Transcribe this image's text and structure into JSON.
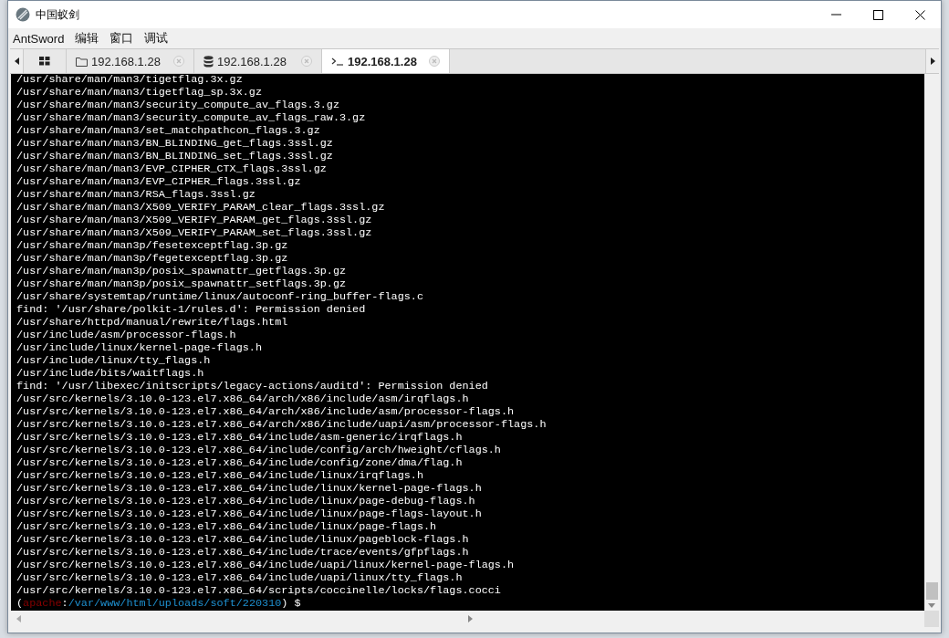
{
  "window": {
    "title": "中国蚁剑"
  },
  "menu": [
    "AntSword",
    "编辑",
    "窗口",
    "调试"
  ],
  "tabs": [
    {
      "kind": "home",
      "selected": false
    },
    {
      "kind": "files",
      "label": "192.168.1.28",
      "selected": false
    },
    {
      "kind": "database",
      "label": "192.168.1.28",
      "selected": false
    },
    {
      "kind": "terminal",
      "label": "192.168.1.28",
      "selected": true
    }
  ],
  "terminal": {
    "lines": [
      "/usr/share/man/man3/tigetflag.3x.gz",
      "/usr/share/man/man3/tigetflag_sp.3x.gz",
      "/usr/share/man/man3/security_compute_av_flags.3.gz",
      "/usr/share/man/man3/security_compute_av_flags_raw.3.gz",
      "/usr/share/man/man3/set_matchpathcon_flags.3.gz",
      "/usr/share/man/man3/BN_BLINDING_get_flags.3ssl.gz",
      "/usr/share/man/man3/BN_BLINDING_set_flags.3ssl.gz",
      "/usr/share/man/man3/EVP_CIPHER_CTX_flags.3ssl.gz",
      "/usr/share/man/man3/EVP_CIPHER_flags.3ssl.gz",
      "/usr/share/man/man3/RSA_flags.3ssl.gz",
      "/usr/share/man/man3/X509_VERIFY_PARAM_clear_flags.3ssl.gz",
      "/usr/share/man/man3/X509_VERIFY_PARAM_get_flags.3ssl.gz",
      "/usr/share/man/man3/X509_VERIFY_PARAM_set_flags.3ssl.gz",
      "/usr/share/man/man3p/fesetexceptflag.3p.gz",
      "/usr/share/man/man3p/fegetexceptflag.3p.gz",
      "/usr/share/man/man3p/posix_spawnattr_getflags.3p.gz",
      "/usr/share/man/man3p/posix_spawnattr_setflags.3p.gz",
      "/usr/share/systemtap/runtime/linux/autoconf-ring_buffer-flags.c",
      "find: '/usr/share/polkit-1/rules.d': Permission denied",
      "/usr/share/httpd/manual/rewrite/flags.html",
      "/usr/include/asm/processor-flags.h",
      "/usr/include/linux/kernel-page-flags.h",
      "/usr/include/linux/tty_flags.h",
      "/usr/include/bits/waitflags.h",
      "find: '/usr/libexec/initscripts/legacy-actions/auditd': Permission denied",
      "/usr/src/kernels/3.10.0-123.el7.x86_64/arch/x86/include/asm/irqflags.h",
      "/usr/src/kernels/3.10.0-123.el7.x86_64/arch/x86/include/asm/processor-flags.h",
      "/usr/src/kernels/3.10.0-123.el7.x86_64/arch/x86/include/uapi/asm/processor-flags.h",
      "/usr/src/kernels/3.10.0-123.el7.x86_64/include/asm-generic/irqflags.h",
      "/usr/src/kernels/3.10.0-123.el7.x86_64/include/config/arch/hweight/cflags.h",
      "/usr/src/kernels/3.10.0-123.el7.x86_64/include/config/zone/dma/flag.h",
      "/usr/src/kernels/3.10.0-123.el7.x86_64/include/linux/irqflags.h",
      "/usr/src/kernels/3.10.0-123.el7.x86_64/include/linux/kernel-page-flags.h",
      "/usr/src/kernels/3.10.0-123.el7.x86_64/include/linux/page-debug-flags.h",
      "/usr/src/kernels/3.10.0-123.el7.x86_64/include/linux/page-flags-layout.h",
      "/usr/src/kernels/3.10.0-123.el7.x86_64/include/linux/page-flags.h",
      "/usr/src/kernels/3.10.0-123.el7.x86_64/include/linux/pageblock-flags.h",
      "/usr/src/kernels/3.10.0-123.el7.x86_64/include/trace/events/gfpflags.h",
      "/usr/src/kernels/3.10.0-123.el7.x86_64/include/uapi/linux/kernel-page-flags.h",
      "/usr/src/kernels/3.10.0-123.el7.x86_64/include/uapi/linux/tty_flags.h",
      "/usr/src/kernels/3.10.0-123.el7.x86_64/scripts/coccinelle/locks/flags.cocci"
    ],
    "prompt": {
      "open": "(",
      "user": "apache",
      "sep": ":",
      "cwd": "/var/www/html/uploads/soft/220310",
      "close": ")",
      "symbol": "$"
    }
  }
}
